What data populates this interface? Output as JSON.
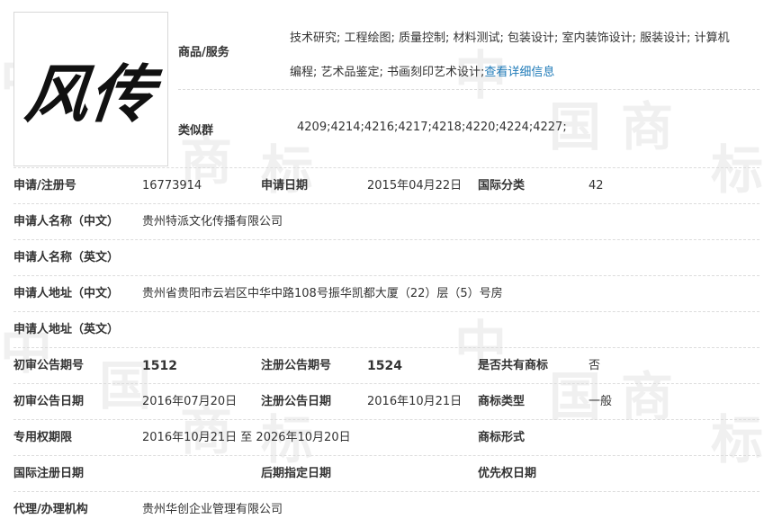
{
  "logo_text": "风传",
  "goods": {
    "label": "商品/服务",
    "line1": "技术研究; 工程绘图; 质量控制; 材料测试; 包装设计; 室内装饰设计; 服装设计; 计算机",
    "line2": "编程; 艺术品鉴定; 书画刻印艺术设计;",
    "detail_link": "查看详细信息"
  },
  "similar": {
    "label": "类似群",
    "value": "4209;4214;4216;4217;4218;4220;4224;4227;"
  },
  "rows": {
    "reg": {
      "l1": "申请/注册号",
      "v1": "16773914",
      "l2": "申请日期",
      "v2": "2015年04月22日",
      "l3": "国际分类",
      "v3": "42"
    },
    "name_cn": {
      "l1": "申请人名称（中文）",
      "v1": "贵州特派文化传播有限公司"
    },
    "name_en": {
      "l1": "申请人名称（英文）",
      "v1": ""
    },
    "addr_cn": {
      "l1": "申请人地址（中文）",
      "v1": "贵州省贵阳市云岩区中华中路108号振华凯都大厦（22）层（5）号房"
    },
    "addr_en": {
      "l1": "申请人地址（英文）",
      "v1": ""
    },
    "pub_no": {
      "l1": "初审公告期号",
      "v1": "1512",
      "l2": "注册公告期号",
      "v2": "1524",
      "l3": "是否共有商标",
      "v3": "否"
    },
    "pub_date": {
      "l1": "初审公告日期",
      "v1": "2016年07月20日",
      "l2": "注册公告日期",
      "v2": "2016年10月21日",
      "l3": "商标类型",
      "v3": "一般"
    },
    "term": {
      "l1": "专用权期限",
      "v1": "2016年10月21日 至 2026年10月20日",
      "l3": "商标形式",
      "v3": ""
    },
    "intl": {
      "l1": "国际注册日期",
      "v1": "",
      "l2": "后期指定日期",
      "v2": "",
      "l3": "优先权日期",
      "v3": ""
    },
    "agent": {
      "l1": "代理/办理机构",
      "v1": "贵州华创企业管理有限公司"
    }
  },
  "watermark": [
    "中",
    "国",
    "商",
    "标"
  ]
}
